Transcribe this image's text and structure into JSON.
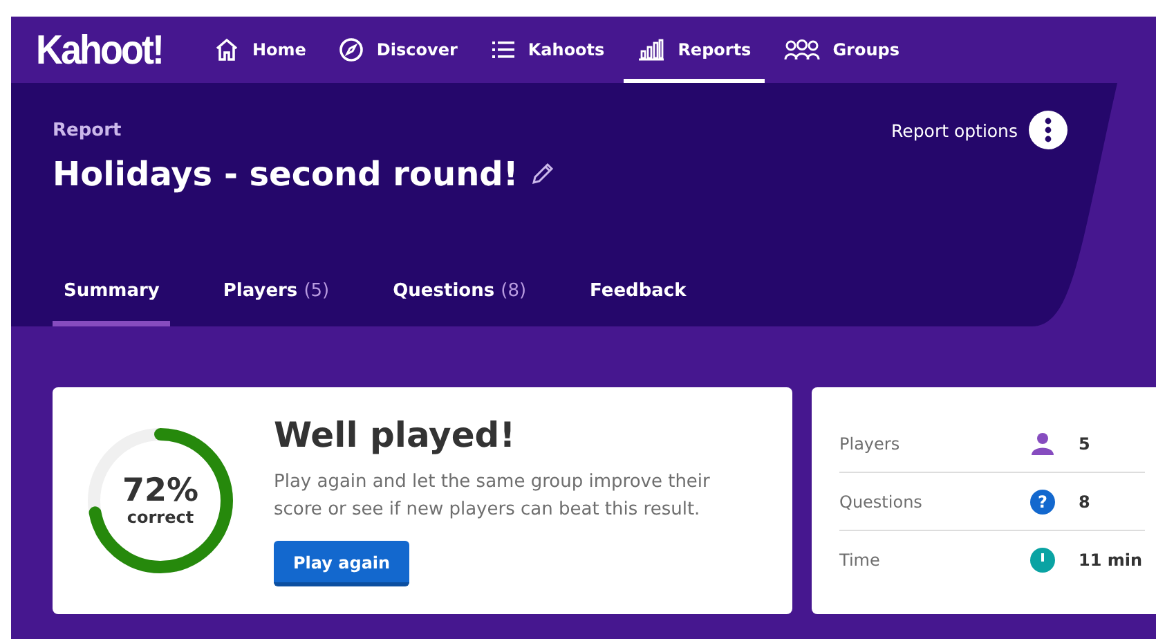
{
  "nav": {
    "logo": "Kahoot!",
    "items": [
      {
        "label": "Home",
        "kind": "home",
        "selected": false
      },
      {
        "label": "Discover",
        "kind": "discover",
        "selected": false
      },
      {
        "label": "Kahoots",
        "kind": "kahoots",
        "selected": false
      },
      {
        "label": "Reports",
        "kind": "reports",
        "selected": true
      },
      {
        "label": "Groups",
        "kind": "groups",
        "selected": false
      }
    ]
  },
  "header": {
    "eyebrow": "Report",
    "title": "Holidays - second round!",
    "options_label": "Report options"
  },
  "tabs": [
    {
      "label": "Summary",
      "selected": true
    },
    {
      "label": "Players",
      "count": "(5)",
      "selected": false
    },
    {
      "label": "Questions",
      "count": "(8)",
      "selected": false
    },
    {
      "label": "Feedback",
      "selected": false
    }
  ],
  "summary": {
    "percent": "72%",
    "percent_caption": "correct",
    "level": 0.72,
    "heading": "Well played!",
    "text": "Play again and let the same group improve their score or see if new players can beat this result.",
    "button": "Play again"
  },
  "stats": [
    {
      "label": "Players",
      "kind": "players",
      "value": "5"
    },
    {
      "label": "Questions",
      "kind": "questions",
      "glyph": "?",
      "value": "8"
    },
    {
      "label": "Time",
      "kind": "time",
      "value": "11 min"
    }
  ]
}
